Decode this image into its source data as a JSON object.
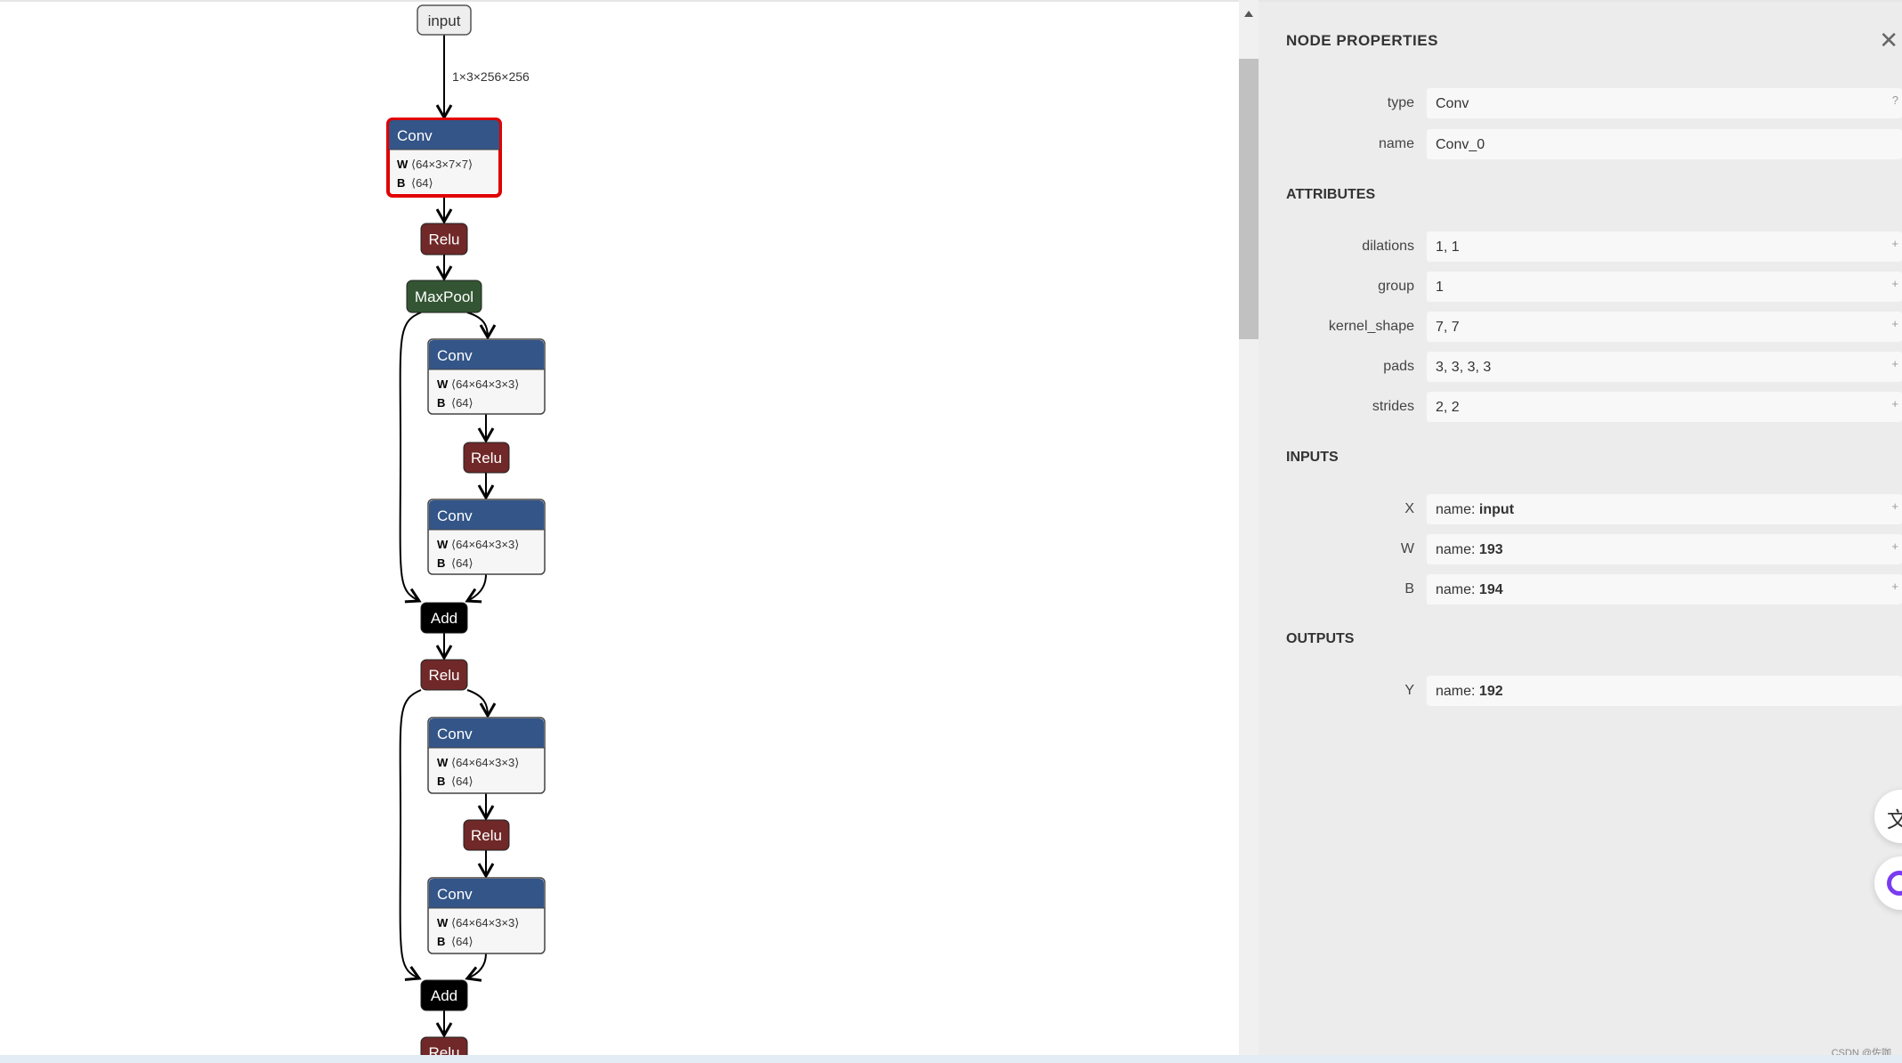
{
  "graph": {
    "input_label": "input",
    "edge_label": "1×3×256×256",
    "nodes": [
      {
        "type": "Conv",
        "W": "⟨64×3×7×7⟩",
        "B": "⟨64⟩",
        "selected": true
      },
      {
        "type": "Relu"
      },
      {
        "type": "MaxPool"
      },
      {
        "type": "Conv",
        "W": "⟨64×64×3×3⟩",
        "B": "⟨64⟩"
      },
      {
        "type": "Relu"
      },
      {
        "type": "Conv",
        "W": "⟨64×64×3×3⟩",
        "B": "⟨64⟩"
      },
      {
        "type": "Add"
      },
      {
        "type": "Relu"
      },
      {
        "type": "Conv",
        "W": "⟨64×64×3×3⟩",
        "B": "⟨64⟩"
      },
      {
        "type": "Relu"
      },
      {
        "type": "Conv",
        "W": "⟨64×64×3×3⟩",
        "B": "⟨64⟩"
      },
      {
        "type": "Add"
      },
      {
        "type": "Relu"
      }
    ],
    "colors": {
      "Conv": "#335588",
      "Relu": "#702828",
      "MaxPool": "#335533",
      "Add": "#000000",
      "selected": "#e00000"
    }
  },
  "panel": {
    "title": "NODE PROPERTIES",
    "close": "✕",
    "type_label": "type",
    "type_value": "Conv",
    "type_help": "?",
    "name_label": "name",
    "name_value": "Conv_0",
    "attributes_header": "ATTRIBUTES",
    "attributes": [
      {
        "label": "dilations",
        "value": "1, 1"
      },
      {
        "label": "group",
        "value": "1"
      },
      {
        "label": "kernel_shape",
        "value": "7, 7"
      },
      {
        "label": "pads",
        "value": "3, 3, 3, 3"
      },
      {
        "label": "strides",
        "value": "2, 2"
      }
    ],
    "inputs_header": "INPUTS",
    "inputs": [
      {
        "label": "X",
        "prefix": "name: ",
        "value": "input"
      },
      {
        "label": "W",
        "prefix": "name: ",
        "value": "193"
      },
      {
        "label": "B",
        "prefix": "name: ",
        "value": "194"
      }
    ],
    "outputs_header": "OUTPUTS",
    "outputs": [
      {
        "label": "Y",
        "prefix": "name: ",
        "value": "192"
      }
    ],
    "expand": "+"
  },
  "watermark": "CSDN @佐咖"
}
